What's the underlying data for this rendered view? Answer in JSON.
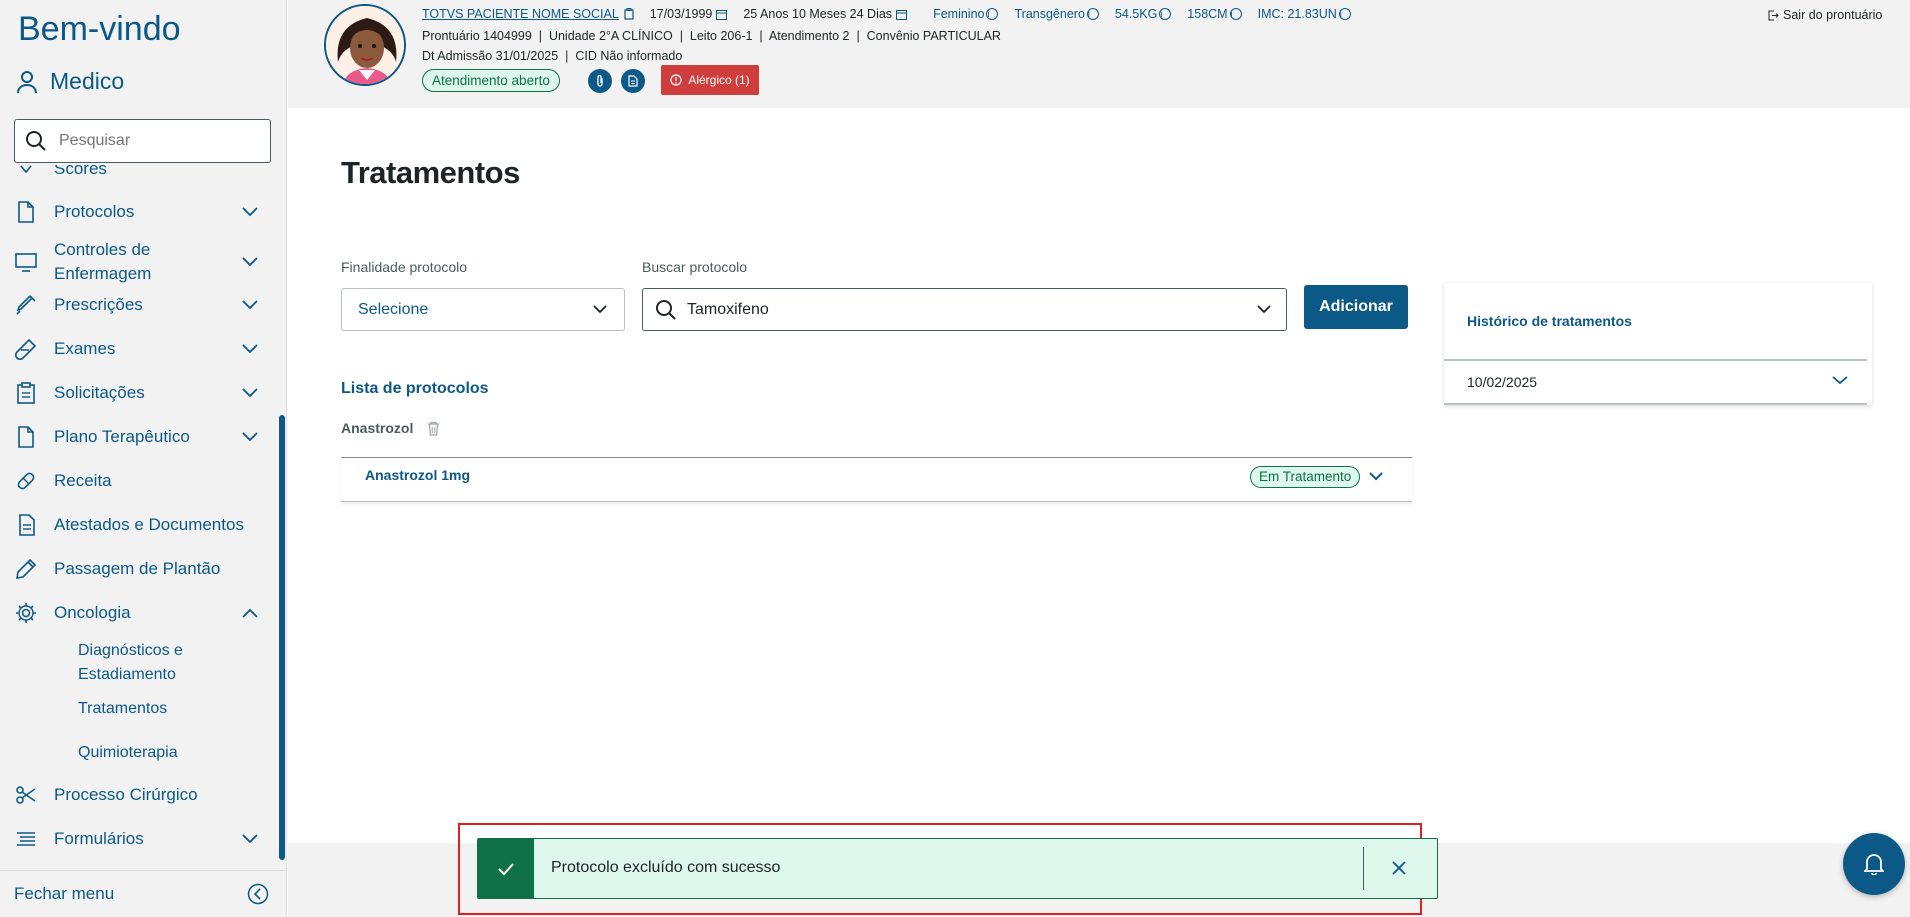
{
  "sidebar": {
    "welcome": "Bem-vindo",
    "user": "Medico",
    "search_placeholder": "Pesquisar",
    "items": [
      {
        "label": "Scores"
      },
      {
        "label": "Protocolos"
      },
      {
        "label": "Controles de Enfermagem"
      },
      {
        "label": "Prescrições"
      },
      {
        "label": "Exames"
      },
      {
        "label": "Solicitações"
      },
      {
        "label": "Plano Terapêutico"
      },
      {
        "label": "Receita"
      },
      {
        "label": "Atestados e Documentos"
      },
      {
        "label": "Passagem de Plantão"
      },
      {
        "label": "Oncologia"
      },
      {
        "label": "Processo Cirúrgico"
      },
      {
        "label": "Formulários"
      }
    ],
    "oncologia_sub": [
      "Diagnósticos e Estadiamento",
      "Tratamentos",
      "Quimioterapia"
    ],
    "close_menu": "Fechar menu"
  },
  "header": {
    "patient_name": "TOTVS PACIENTE NOME SOCIAL",
    "birth_date": "17/03/1999",
    "age": "25 Anos 10 Meses 24 Dias",
    "sex": "Feminino",
    "gender": "Transgênero",
    "weight": "54.5KG",
    "height": "158CM",
    "imc": "IMC: 21.83UN",
    "row2": "Prontuário 1404999  |  Unidade 2°A CLÍNICO  |  Leito 206-1  |  Atendimento 2  |  Convênio PARTICULAR",
    "row3": "Dt Admissão 31/01/2025  |  CID Não informado",
    "status_badge": "Atendimento aberto",
    "allergic": "Alérgico (1)",
    "logout": "Sair do prontuário"
  },
  "main": {
    "title": "Tratamentos",
    "finalidade_label": "Finalidade protocolo",
    "finalidade_value": "Selecione",
    "buscar_label": "Buscar protocolo",
    "buscar_value": "Tamoxifeno",
    "add_button": "Adicionar",
    "list_title": "Lista de protocolos",
    "group": "Anastrozol",
    "protocols": [
      {
        "name": "Anastrozol 1mg",
        "status": "Em Tratamento"
      }
    ]
  },
  "history": {
    "title": "Histórico de tratamentos",
    "date": "10/02/2025"
  },
  "toast": {
    "message": "Protocolo excluído com sucesso"
  },
  "colors": {
    "primary": "#0c5987",
    "success": "#107048",
    "success_bg": "#def7ed",
    "danger": "#cf3d3d",
    "highlight": "#e02020"
  }
}
